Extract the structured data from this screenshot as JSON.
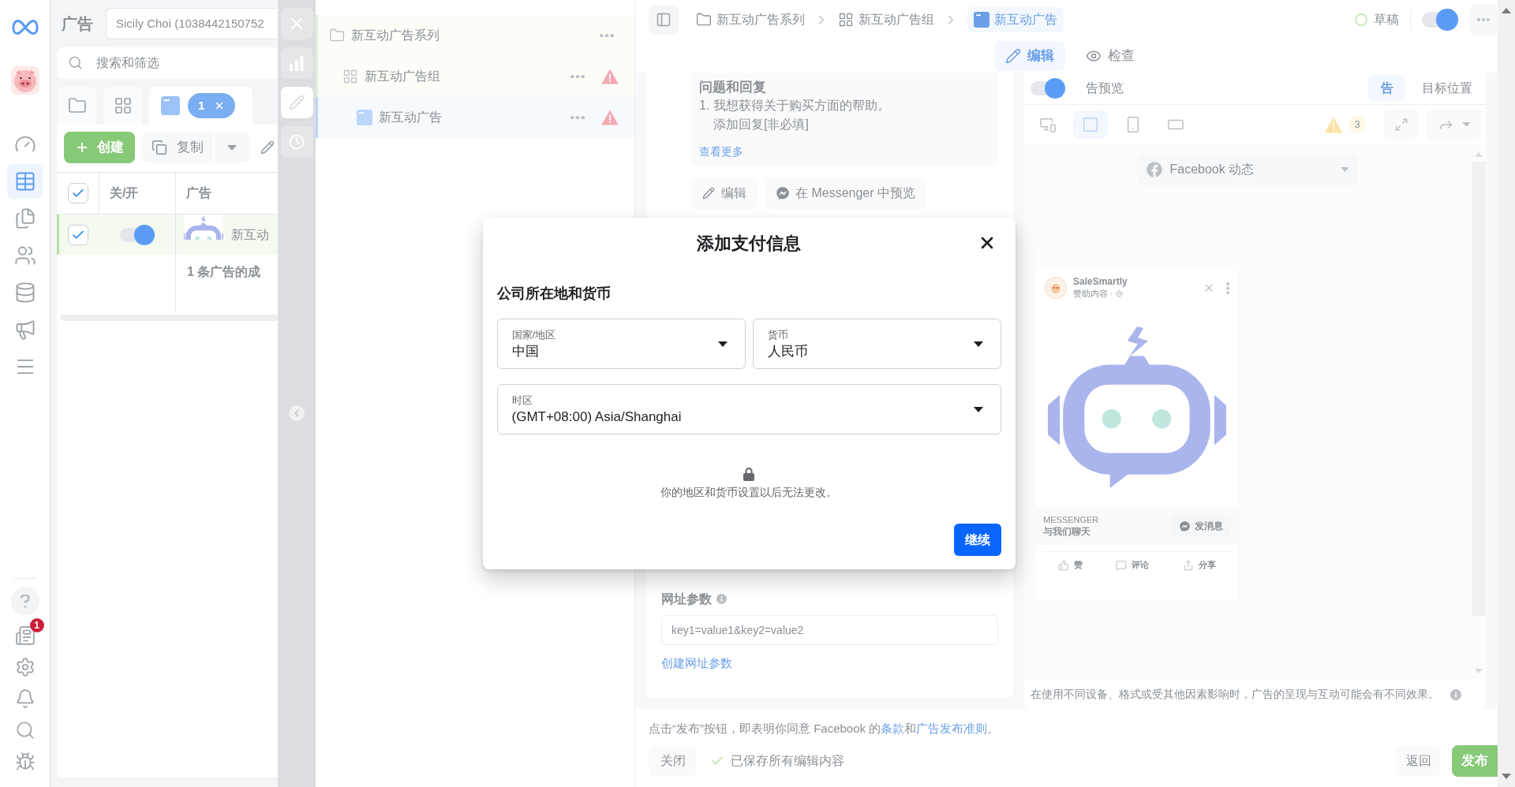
{
  "nav_rail": {
    "items": [
      {
        "selected": false
      },
      {
        "selected": true
      },
      {
        "selected": false
      },
      {
        "selected": false
      },
      {
        "selected": false
      },
      {
        "selected": false
      },
      {
        "selected": false
      }
    ],
    "notification_badge": "1"
  },
  "ads_panel": {
    "title": "广告",
    "account": "Sicily Choi (1038442150752",
    "search": {
      "placeholder": "搜索和筛选"
    },
    "level_tabs": [
      {
        "selected": false
      },
      {
        "selected": false
      },
      {
        "selected": true
      }
    ],
    "filter_chip": "1",
    "toolbar": {
      "create": "创建",
      "duplicate": "复制"
    },
    "table": {
      "all_checked": true,
      "columns": [
        "关/开",
        "广告"
      ],
      "rows": [
        {
          "checked": true,
          "on": true,
          "name": "新互动"
        }
      ],
      "summary": "1 条广告的成"
    }
  },
  "side_tools": [
    {
      "selected": false
    },
    {
      "selected": true
    },
    {
      "selected": false
    }
  ],
  "tree": [
    {
      "label": "新互动广告系列",
      "selected": false,
      "warning": false,
      "children": [
        {
          "label": "新互动广告组",
          "selected": false,
          "warning": true,
          "children": [
            {
              "label": "新互动广告",
              "selected": true,
              "warning": true
            }
          ]
        }
      ]
    }
  ],
  "breadcrumb": [
    {
      "label": "新互动广告系列",
      "selected": false
    },
    {
      "label": "新互动广告组",
      "selected": false
    },
    {
      "label": "新互动广告",
      "selected": true
    }
  ],
  "status": {
    "label": "草稿",
    "on": true
  },
  "tabs": [
    {
      "label": "编辑",
      "selected": true
    },
    {
      "label": "检查",
      "selected": false
    }
  ],
  "question_card": {
    "title": "问题和回复",
    "question": "1. 我想获得关于购买方面的帮助。",
    "reply_prompt": "添加回复[非必填]",
    "more_link": "查看更多"
  },
  "card_buttons": [
    "编辑",
    "在 Messenger 中预览"
  ],
  "url_params": {
    "label": "网址参数",
    "placeholder": "key1=value1&key2=value2",
    "link": "创建网址参数"
  },
  "preview": {
    "toggle_on": true,
    "label": "告预览",
    "tabs": [
      {
        "label": "告",
        "selected": true
      },
      {
        "label": "目标位置",
        "selected": false
      }
    ],
    "formats": [
      {
        "selected": false
      },
      {
        "selected": true
      },
      {
        "selected": false
      },
      {
        "selected": false
      }
    ],
    "warning_count": "3",
    "placement": "Facebook 动态",
    "ad": {
      "page": "SaleSmartly",
      "sponsored": "赞助内容 ·",
      "cta_caption": "MESSENGER",
      "headline": "与我们聊天",
      "cta_button": "发消息",
      "actions": [
        "赞",
        "评论",
        "分享"
      ]
    },
    "note": "在使用不同设备、格式或受其他因素影响时，广告的呈现与互动可能会有不同效果。"
  },
  "footer": {
    "terms": [
      {
        "kind": "text",
        "text": "点击“发布”按钮，即表明你同意 Facebook 的"
      },
      {
        "kind": "link",
        "text": "条款"
      },
      {
        "kind": "text",
        "text": "和"
      },
      {
        "kind": "link",
        "text": "广告发布准则"
      },
      {
        "kind": "text",
        "text": "。"
      }
    ],
    "close": "关闭",
    "saved": "已保存所有编辑内容",
    "back": "返回",
    "publish": "发布"
  },
  "modal": {
    "title": "添加支付信息",
    "section": "公司所在地和货币",
    "fields": [
      {
        "label": "国家/地区",
        "value": "中国"
      },
      {
        "label": "货币",
        "value": "人民币"
      },
      {
        "label": "时区",
        "value": "(GMT+08:00) Asia/Shanghai"
      }
    ],
    "notice": "你的地区和货币设置以后无法更改。",
    "continue": "继续"
  }
}
